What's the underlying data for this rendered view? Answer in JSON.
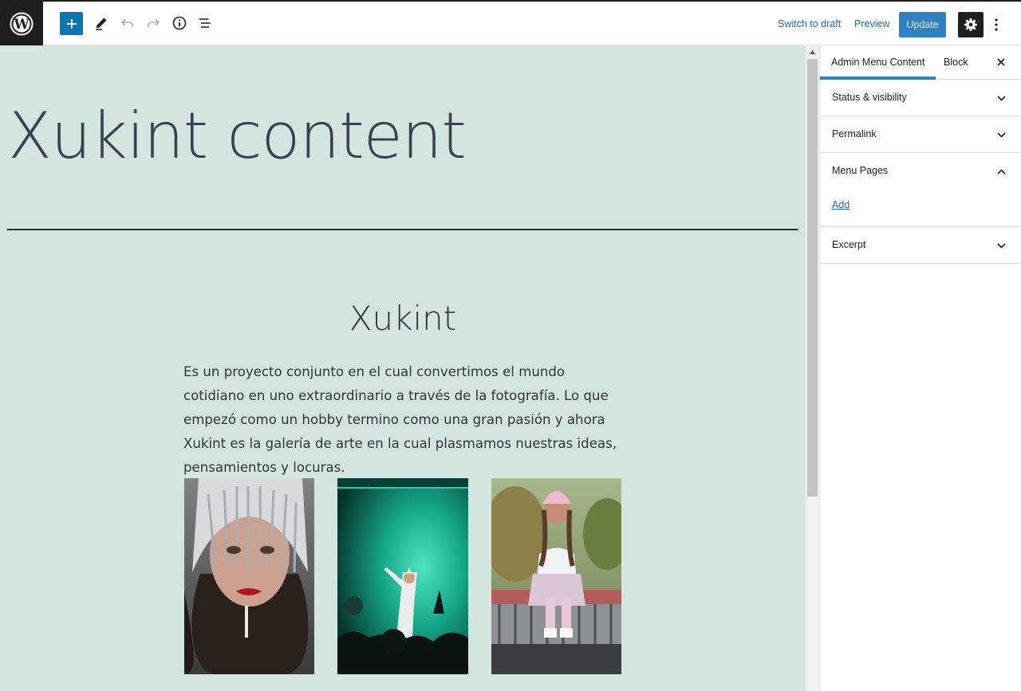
{
  "toolbar": {
    "logo_icon": "wordpress-logo",
    "inserter_icon": "plus-icon",
    "tools_icon": "pencil-icon",
    "undo_icon": "undo-icon",
    "redo_icon": "redo-icon",
    "details_icon": "info-icon",
    "outline_icon": "list-view-icon",
    "switch_to_draft": "Switch to draft",
    "preview": "Preview",
    "update": "Update",
    "settings_icon": "gear-icon",
    "more_icon": "more-vertical-icon"
  },
  "canvas": {
    "background": "#d3e5df",
    "page_title": "Xukint content",
    "section_heading": "Xukint",
    "section_text": "Es un proyecto conjunto en el cual convertimos el mundo cotidiano en uno extraordinario a través de la fotografía. Lo que empezó como un hobby termino como una gran pasión y ahora Xukint es la galería de arte en la cual plasmamos nuestras ideas, pensamientos y locuras."
  },
  "sidebar": {
    "tabs": [
      {
        "label": "Admin Menu Content",
        "active": true
      },
      {
        "label": "Block",
        "active": false
      }
    ],
    "close_icon": "close-icon",
    "panels": [
      {
        "title": "Status & visibility",
        "expanded": false
      },
      {
        "title": "Permalink",
        "expanded": false
      },
      {
        "title": "Menu Pages",
        "expanded": true,
        "link": "Add"
      },
      {
        "title": "Excerpt",
        "expanded": false
      }
    ]
  },
  "colors": {
    "accent": "#2f82c2",
    "dark": "#1e1e1e",
    "link": "#1f6fa5"
  }
}
